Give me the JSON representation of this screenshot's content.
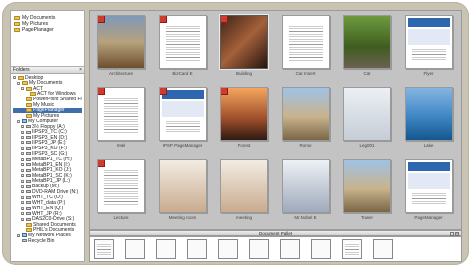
{
  "favorites": [
    "My Documents",
    "My Pictures",
    "PagePlanager"
  ],
  "folders_header": "Folders",
  "tree": [
    {
      "label": "Desktop",
      "indent": 0,
      "icon": "folder",
      "exp": "-"
    },
    {
      "label": "My Documents",
      "indent": 1,
      "icon": "folder",
      "exp": "-"
    },
    {
      "label": "ACT",
      "indent": 2,
      "icon": "folder",
      "exp": "-"
    },
    {
      "label": "ACT for Windows",
      "indent": 3,
      "icon": "folder",
      "exp": ""
    },
    {
      "label": "PowerPoint Shared Files",
      "indent": 2,
      "icon": "folder",
      "exp": ""
    },
    {
      "label": "My Music",
      "indent": 2,
      "icon": "folder",
      "exp": ""
    },
    {
      "label": "PagePlanager",
      "indent": 2,
      "icon": "folder",
      "exp": "",
      "selected": true
    },
    {
      "label": "My Pictures",
      "indent": 2,
      "icon": "folder",
      "exp": ""
    },
    {
      "label": "My Computer",
      "indent": 1,
      "icon": "pc",
      "exp": "-"
    },
    {
      "label": "3½ Floppy (A:)",
      "indent": 2,
      "icon": "drive",
      "exp": "+"
    },
    {
      "label": "IIPSP3_TC (C:)",
      "indent": 2,
      "icon": "drive",
      "exp": "+"
    },
    {
      "label": "IIPSP3_EN (D:)",
      "indent": 2,
      "icon": "drive",
      "exp": "+"
    },
    {
      "label": "IIPSP3_JP (E:)",
      "indent": 2,
      "icon": "drive",
      "exp": "+"
    },
    {
      "label": "IIPSP3_KO (F:)",
      "indent": 2,
      "icon": "drive",
      "exp": "+"
    },
    {
      "label": "IIPSP3_SC (G:)",
      "indent": 2,
      "icon": "drive",
      "exp": "+"
    },
    {
      "label": "MetaBP1_TC (H:)",
      "indent": 2,
      "icon": "drive",
      "exp": "+"
    },
    {
      "label": "MetaBP1_EN (I:)",
      "indent": 2,
      "icon": "drive",
      "exp": "+"
    },
    {
      "label": "MetaBP1_KO (J:)",
      "indent": 2,
      "icon": "drive",
      "exp": "+"
    },
    {
      "label": "MetaBP1_SC (K:)",
      "indent": 2,
      "icon": "drive",
      "exp": "+"
    },
    {
      "label": "MetaBP1_JP (L:)",
      "indent": 2,
      "icon": "drive",
      "exp": "+"
    },
    {
      "label": "Backup (M:)",
      "indent": 2,
      "icon": "drive",
      "exp": "+"
    },
    {
      "label": "DVD-RAM Drive (N:)",
      "indent": 2,
      "icon": "drive",
      "exp": "+"
    },
    {
      "label": "WHT_TC (O:)",
      "indent": 2,
      "icon": "drive",
      "exp": "+"
    },
    {
      "label": "WHT_data (P:)",
      "indent": 2,
      "icon": "drive",
      "exp": "+"
    },
    {
      "label": "WHT_EN (Q:)",
      "indent": 2,
      "icon": "drive",
      "exp": "+"
    },
    {
      "label": "WHT_JP (R:)",
      "indent": 2,
      "icon": "drive",
      "exp": "+"
    },
    {
      "label": "DAS2C0-Drive (S:)",
      "indent": 2,
      "icon": "drive",
      "exp": "+"
    },
    {
      "label": "Shared Documents",
      "indent": 2,
      "icon": "folder",
      "exp": ""
    },
    {
      "label": "PHIL's Documents",
      "indent": 2,
      "icon": "folder",
      "exp": ""
    },
    {
      "label": "My Network Places",
      "indent": 1,
      "icon": "pc",
      "exp": "+"
    },
    {
      "label": "Recycle Bin",
      "indent": 1,
      "icon": "drive",
      "exp": ""
    }
  ],
  "thumbnails": [
    {
      "caption": "Architecture",
      "style": "photo-a",
      "badge": true
    },
    {
      "caption": "BizCard E",
      "style": "doc",
      "badge": true
    },
    {
      "caption": "Building",
      "style": "photo-b",
      "badge": true,
      "selected": true
    },
    {
      "caption": "Car Insert",
      "style": "doc",
      "badge": false
    },
    {
      "caption": "Cat",
      "style": "photo-c",
      "badge": false
    },
    {
      "caption": "Flyer",
      "style": "brochure",
      "badge": false
    },
    {
      "caption": "Intel",
      "style": "doc",
      "badge": true
    },
    {
      "caption": "IPSP PageManager",
      "style": "brochure",
      "badge": true
    },
    {
      "caption": "Forest",
      "style": "photo-h",
      "badge": true
    },
    {
      "caption": "Rome",
      "style": "photo-d",
      "badge": false
    },
    {
      "caption": "Leg001",
      "style": "photo-f",
      "badge": false
    },
    {
      "caption": "Lake",
      "style": "photo-e",
      "badge": false
    },
    {
      "caption": "Lecture",
      "style": "doc",
      "badge": true
    },
    {
      "caption": "Meeting room",
      "style": "photo-g",
      "badge": false
    },
    {
      "caption": "meeting",
      "style": "photo-g",
      "badge": false
    },
    {
      "caption": "Mr.Nobel E",
      "style": "photo-i",
      "badge": false
    },
    {
      "caption": "Tower",
      "style": "photo-d",
      "badge": false
    },
    {
      "caption": "PageManager",
      "style": "brochure",
      "badge": false
    }
  ],
  "palette": {
    "title": "Document Pallet",
    "items": [
      "doc",
      "photo-a",
      "photo-b",
      "photo-c",
      "photo-d",
      "photo-f",
      "photo-e",
      "photo-g",
      "doc",
      "photo-j"
    ]
  },
  "colors": {
    "frame": "#c8c3b2",
    "selection": "#3f6ea8",
    "badge": "#d23a2b"
  }
}
